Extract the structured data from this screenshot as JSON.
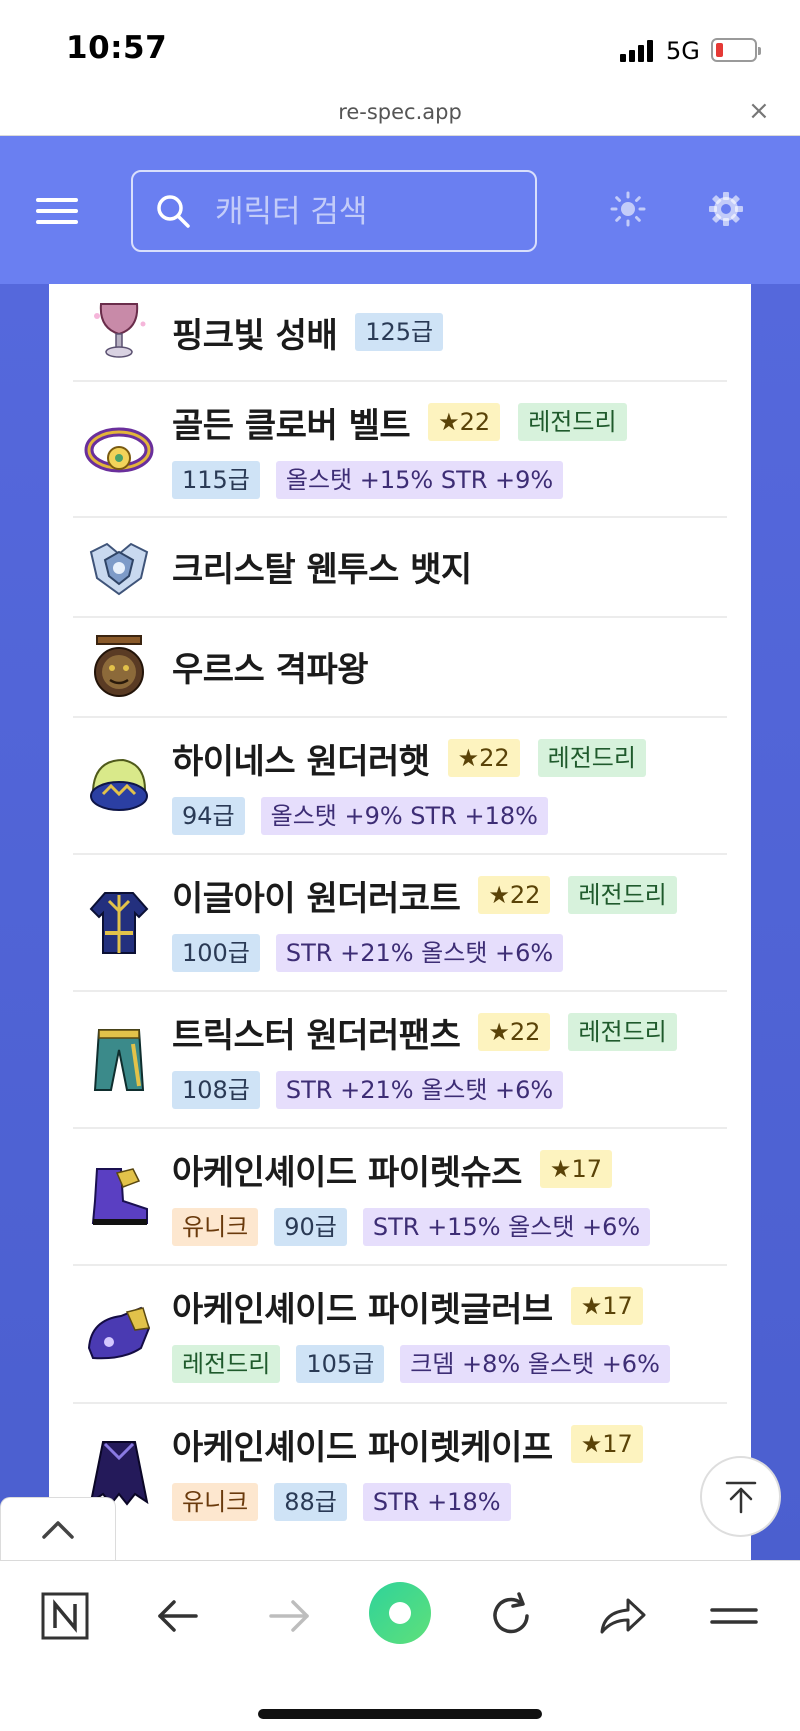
{
  "status_bar": {
    "time": "10:57",
    "network": "5G"
  },
  "url_bar": {
    "domain": "re-spec.app",
    "close_icon": "×"
  },
  "header": {
    "search_placeholder": "캐릭터 검색"
  },
  "colors": {
    "brand": "#6a7ff1",
    "level_tag": "#cfe3f6",
    "star_tag": "#fdf3bf",
    "legendary_tag": "#d7f2dc",
    "option_tag": "#e6defc",
    "unique_tag": "#fde7cf"
  },
  "items": [
    {
      "name": "핑크빛 성배",
      "icon": "pink-goblet-icon",
      "inline_tags": [
        "125급"
      ],
      "tags": []
    },
    {
      "name": "골든 클로버 벨트",
      "icon": "golden-clover-belt-icon",
      "inline_tags": [
        "★22",
        "레전드리"
      ],
      "tags": [
        "115급",
        "올스탯 +15% STR +9%"
      ]
    },
    {
      "name": "크리스탈 웬투스 뱃지",
      "icon": "crystal-ventus-badge-icon",
      "inline_tags": [],
      "tags": []
    },
    {
      "name": "우르스 격파왕",
      "icon": "urus-medal-icon",
      "inline_tags": [],
      "tags": []
    },
    {
      "name": "하이네스 원더러햇",
      "icon": "wanderer-hat-icon",
      "inline_tags": [
        "★22",
        "레전드리"
      ],
      "tags": [
        "94급",
        "올스탯 +9% STR +18%"
      ]
    },
    {
      "name": "이글아이 원더러코트",
      "icon": "wanderer-coat-icon",
      "inline_tags": [
        "★22",
        "레전드리"
      ],
      "tags": [
        "100급",
        "STR +21% 올스탯 +6%"
      ]
    },
    {
      "name": "트릭스터 원더러팬츠",
      "icon": "wanderer-pants-icon",
      "inline_tags": [
        "★22",
        "레전드리"
      ],
      "tags": [
        "108급",
        "STR +21% 올스탯 +6%"
      ]
    },
    {
      "name": "아케인셰이드 파이렛슈즈",
      "icon": "pirate-shoes-icon",
      "inline_tags": [
        "★17"
      ],
      "tags": [
        "유니크",
        "90급",
        "STR +15% 올스탯 +6%"
      ]
    },
    {
      "name": "아케인셰이드 파이렛글러브",
      "icon": "pirate-gloves-icon",
      "inline_tags": [
        "★17"
      ],
      "tags": [
        "레전드리",
        "105급",
        "크뎀 +8% 올스탯 +6%"
      ]
    },
    {
      "name": "아케인셰이드 파이렛케이프",
      "icon": "pirate-cape-icon",
      "inline_tags": [
        "★17"
      ],
      "tags": [
        "유니크",
        "88급",
        "STR +18%"
      ]
    }
  ],
  "toolbar": {
    "icons": [
      "naver-home-icon",
      "back-arrow-icon",
      "forward-arrow-icon",
      "green-dot-icon",
      "reload-icon",
      "share-icon",
      "menu-icon"
    ]
  }
}
